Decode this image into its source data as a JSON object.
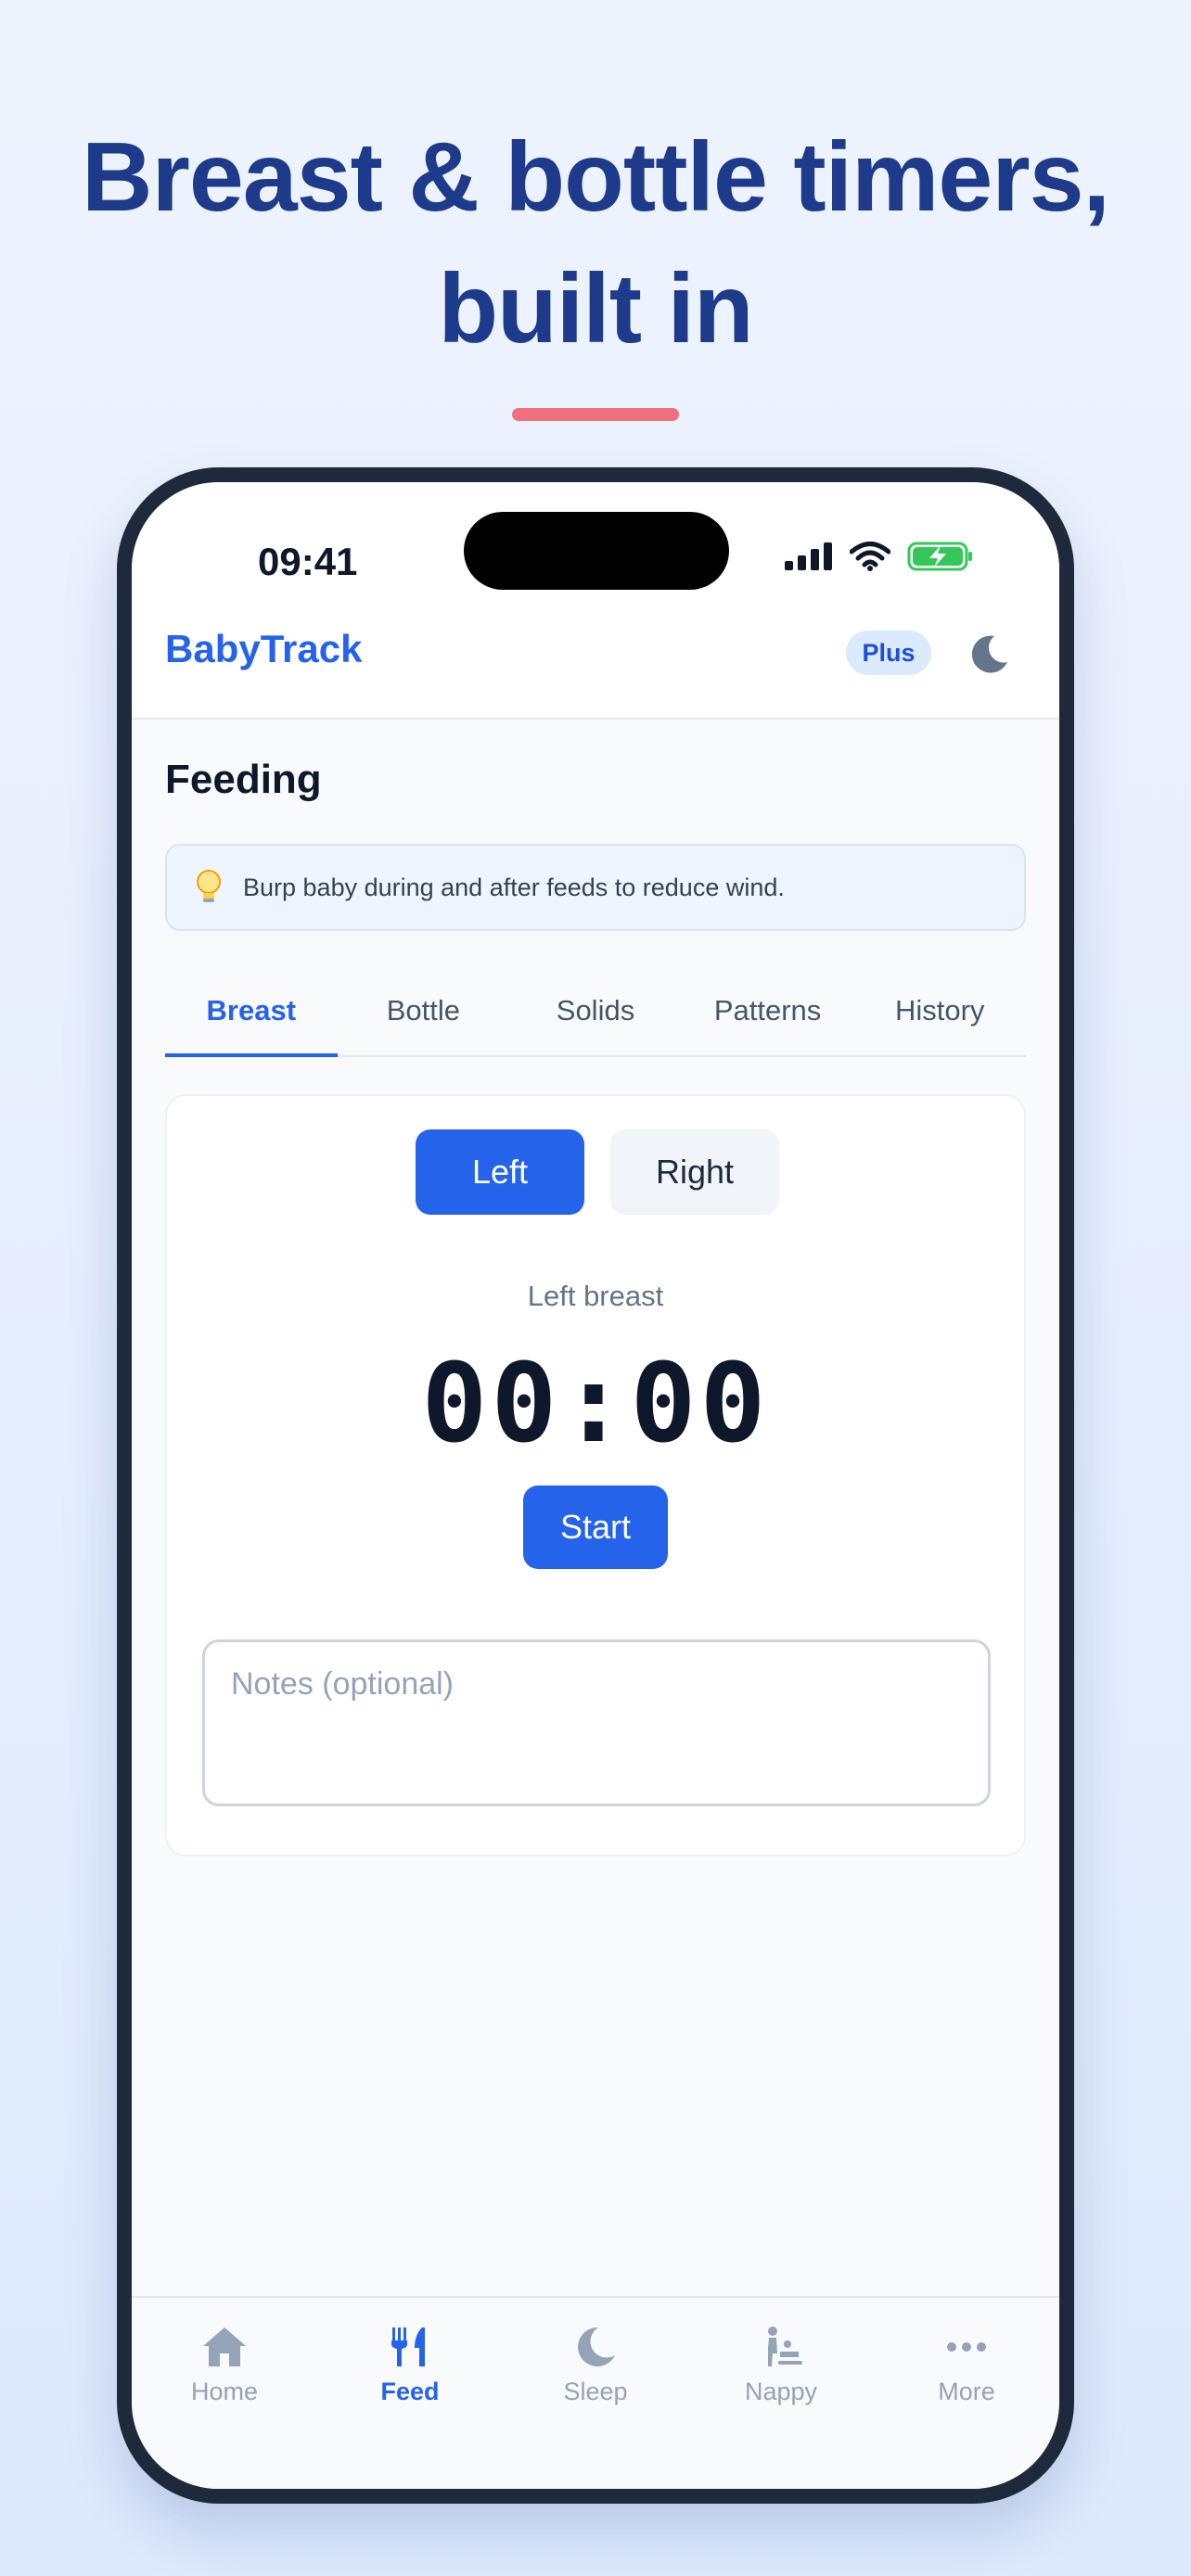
{
  "headline": {
    "line1": "Breast & bottle timers,",
    "line2": "built in"
  },
  "status_bar": {
    "time": "09:41"
  },
  "app": {
    "title": "BabyTrack",
    "badge": "Plus"
  },
  "page": {
    "title": "Feeding"
  },
  "tip": {
    "icon": "lightbulb-icon",
    "text": "Burp baby during and after feeds to reduce wind."
  },
  "tabs": [
    {
      "label": "Breast",
      "active": true
    },
    {
      "label": "Bottle"
    },
    {
      "label": "Solids"
    },
    {
      "label": "Patterns"
    },
    {
      "label": "History"
    }
  ],
  "breast_timer": {
    "left_label": "Left",
    "right_label": "Right",
    "selected_side": "Left",
    "timer_label": "Left breast",
    "timer_value": "00:00",
    "start_label": "Start",
    "notes_placeholder": "Notes (optional)",
    "notes_value": ""
  },
  "nav": [
    {
      "label": "Home",
      "icon": "home-icon"
    },
    {
      "label": "Feed",
      "icon": "fork-knife-icon",
      "active": true
    },
    {
      "label": "Sleep",
      "icon": "moon-icon"
    },
    {
      "label": "Nappy",
      "icon": "baby-changing-icon"
    },
    {
      "label": "More",
      "icon": "more-dots-icon"
    }
  ],
  "colors": {
    "accent": "#2563eb",
    "headline": "#1e3a8a",
    "underline": "#f0707f",
    "phone_frame": "#1e293b",
    "battery": "#34c759"
  }
}
